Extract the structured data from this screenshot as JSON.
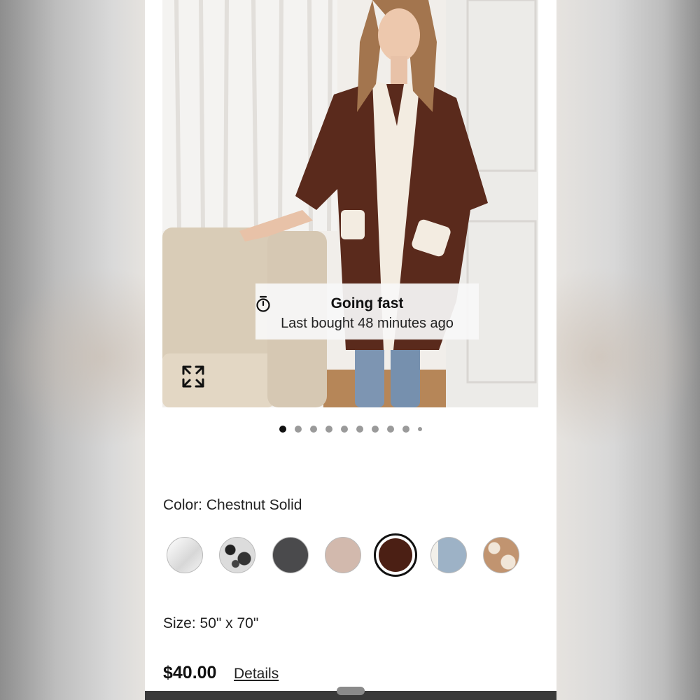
{
  "badge": {
    "title": "Going fast",
    "subtitle": "Last bought 48 minutes ago",
    "icon": "stopwatch-icon"
  },
  "gallery": {
    "image_count": 10,
    "active_index": 0,
    "expand_icon": "expand-arrows-icon"
  },
  "color": {
    "label": "Color: Chestnut Solid",
    "selected_index": 4,
    "swatches": [
      {
        "name": "white",
        "color": "#e9e9e9"
      },
      {
        "name": "black-white-pattern",
        "color": "#d8d8d8"
      },
      {
        "name": "charcoal",
        "color": "#4a4a4c"
      },
      {
        "name": "blush",
        "color": "#d2b9ad"
      },
      {
        "name": "chestnut",
        "color": "#4b1f14"
      },
      {
        "name": "denim",
        "color": "#9db2c6"
      },
      {
        "name": "cow-print",
        "color": "#c19470"
      }
    ]
  },
  "size": {
    "label": "Size: 50\" x 70\""
  },
  "price": {
    "amount": "$40.00",
    "details_label": "Details"
  }
}
